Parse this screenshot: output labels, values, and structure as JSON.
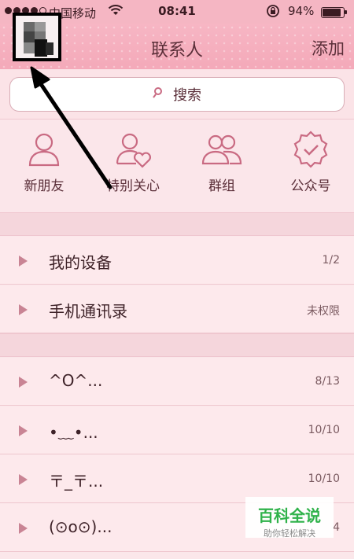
{
  "status_bar": {
    "carrier": "中国移动",
    "time": "08:41",
    "battery": "94%",
    "battery_level": 0.94
  },
  "nav": {
    "title": "联系人",
    "add_label": "添加"
  },
  "search": {
    "placeholder": "搜索"
  },
  "quick_actions": [
    {
      "label": "新朋友",
      "icon": "person-icon"
    },
    {
      "label": "特别关心",
      "icon": "person-heart-icon"
    },
    {
      "label": "群组",
      "icon": "group-icon"
    },
    {
      "label": "公众号",
      "icon": "badge-check-icon"
    }
  ],
  "groups": [
    {
      "name": "我的设备",
      "count": "1/2"
    },
    {
      "name": "手机通讯录",
      "count": "未权限"
    }
  ],
  "friend_groups": [
    {
      "name": "^O^...",
      "count": "8/13"
    },
    {
      "name": "•﹏•...",
      "count": "10/10"
    },
    {
      "name": "〒_〒...",
      "count": "10/10"
    },
    {
      "name": "(⊙o⊙)...",
      "count": "4"
    }
  ],
  "watermark": {
    "title": "百科全说",
    "subtitle": "助你轻松解决"
  },
  "colors": {
    "accent": "#f5b6c3",
    "text": "#5a2e38",
    "icon": "#c96a82"
  }
}
